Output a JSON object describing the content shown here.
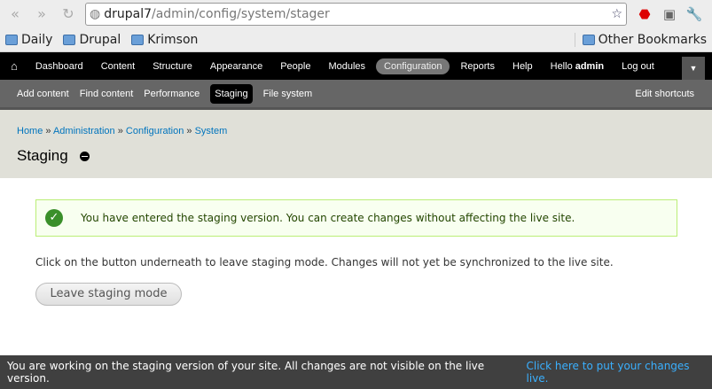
{
  "browser": {
    "url_host": "drupal7",
    "url_path": "/admin/config/system/stager",
    "bookmarks": [
      "Daily",
      "Drupal",
      "Krimson"
    ],
    "other_bookmarks": "Other Bookmarks"
  },
  "toolbar": {
    "items": [
      "Dashboard",
      "Content",
      "Structure",
      "Appearance",
      "People",
      "Modules",
      "Configuration",
      "Reports",
      "Help"
    ],
    "hello": "Hello",
    "user": "admin",
    "logout": "Log out"
  },
  "shortcuts": {
    "items": [
      "Add content",
      "Find content",
      "Performance",
      "Staging",
      "File system"
    ],
    "edit": "Edit shortcuts"
  },
  "breadcrumb": [
    "Home",
    "Administration",
    "Configuration",
    "System"
  ],
  "page_title": "Staging",
  "message": "You have entered the staging version. You can create changes without affecting the live site.",
  "info": "Click on the button underneath to leave staging mode. Changes will not yet be synchronized to the live site.",
  "button": "Leave staging mode",
  "footer": {
    "text": "You are working on the staging version of your site. All changes are not visible on the live version.",
    "link": "Click here to put your changes live."
  }
}
